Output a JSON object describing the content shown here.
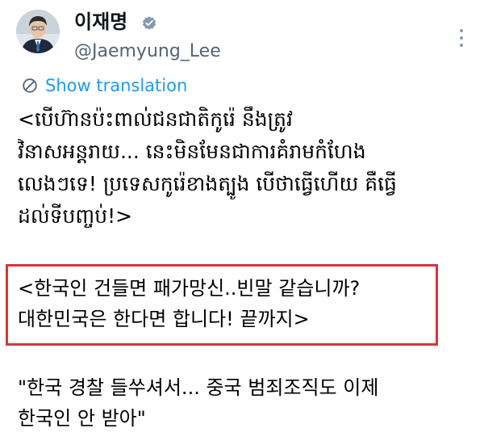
{
  "tweet": {
    "author": {
      "display_name": "이재명",
      "handle": "@Jaemyung_Lee",
      "verified": true,
      "avatar_icon": "profile-photo"
    },
    "more_icon": "more-options-icon",
    "translate": {
      "icon": "translate-globe-icon",
      "label": "Show translation"
    },
    "colors": {
      "link": "#1d9bf0",
      "secondary_text": "#536471",
      "highlight_border": "#d8343e"
    },
    "khmer_caption": [
      "<បើហ៊ានប៉ះពាល់ជនជាតិកូរ៉េ នឹងត្រូវ",
      "វិនាសអន្តរាយ... នេះមិនមែនជាការគំរាមកំហែង",
      "លេងៗទេ! ប្រទេសកូរ៉េខាងត្បូង បើថាធ្វើហើយ គឺធ្វើ",
      "ដល់ទីបញ្ចប់!>"
    ],
    "highlighted_text": [
      "<한국인 건들면 패가망신..빈말 같습니까?",
      "대한민국은 한다면 합니다! 끝까지>"
    ],
    "quote_text": [
      "\"한국 경찰 들쑤셔서... 중국 범죄조직도 이제",
      "한국인 안 받아\""
    ]
  }
}
